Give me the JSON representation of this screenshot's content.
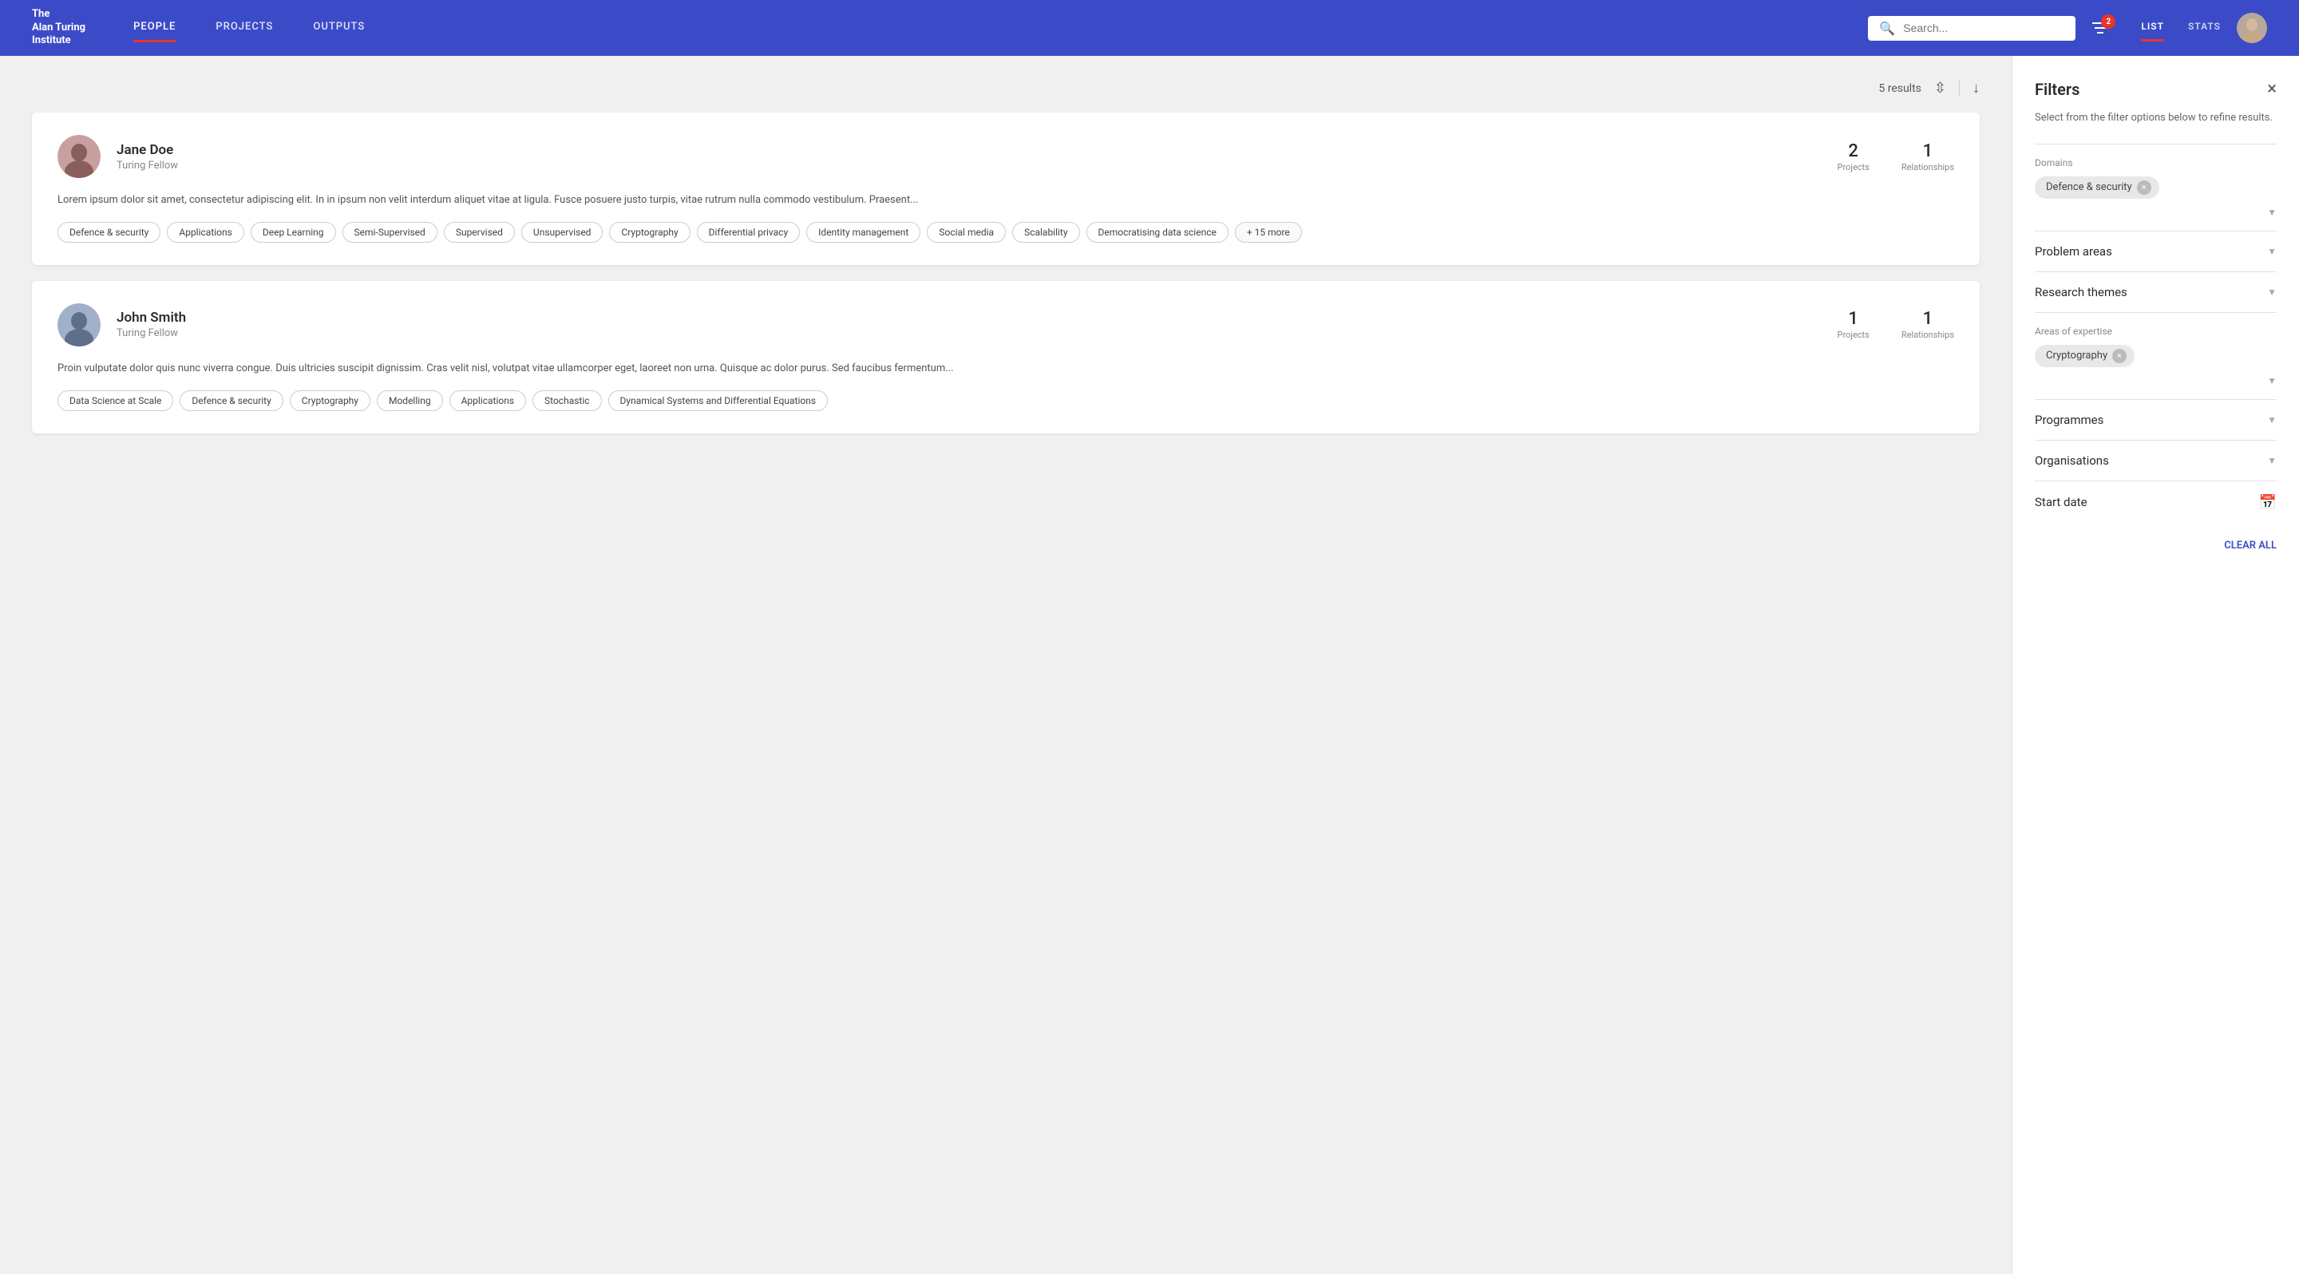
{
  "header": {
    "logo": [
      "The",
      "Alan Turing",
      "Institute"
    ],
    "nav": [
      {
        "label": "PEOPLE",
        "active": true
      },
      {
        "label": "PROJECTS",
        "active": false
      },
      {
        "label": "OUTPUTS",
        "active": false
      }
    ],
    "search_placeholder": "Search...",
    "filter_badge": "2",
    "view_tabs": [
      {
        "label": "LIST",
        "active": true
      },
      {
        "label": "STATS",
        "active": false
      }
    ]
  },
  "results": {
    "count": "5 results"
  },
  "people": [
    {
      "name": "Jane Doe",
      "role": "Turing Fellow",
      "projects": "2",
      "relationships": "1",
      "projects_label": "Projects",
      "relationships_label": "Relationships",
      "bio": "Lorem ipsum dolor sit amet, consectetur adipiscing elit. In in ipsum non velit interdum aliquet vitae at ligula. Fusce posuere justo turpis, vitae rutrum nulla commodo vestibulum. Praesent...",
      "tags": [
        "Defence & security",
        "Applications",
        "Deep Learning",
        "Semi-Supervised",
        "Supervised",
        "Unsupervised",
        "Cryptography",
        "Differential privacy",
        "Identity management",
        "Social media",
        "Scalability",
        "Democratising data science"
      ],
      "more": "+ 15 more"
    },
    {
      "name": "John Smith",
      "role": "Turing Fellow",
      "projects": "1",
      "relationships": "1",
      "projects_label": "Projects",
      "relationships_label": "Relationships",
      "bio": "Proin vulputate dolor quis nunc viverra congue. Duis ultricies suscipit dignissim. Cras velit nisl, volutpat vitae ullamcorper eget, laoreet non urna. Quisque ac dolor purus. Sed faucibus fermentum...",
      "tags": [
        "Data Science at Scale",
        "Defence & security",
        "Cryptography",
        "Modelling",
        "Applications",
        "Stochastic",
        "Dynamical Systems and Differential Equations"
      ],
      "more": null
    }
  ],
  "filters": {
    "title": "Filters",
    "subtitle": "Select from the filter options below to refine results.",
    "sections": [
      {
        "id": "domains",
        "label": "Domains",
        "active_tags": [
          "Defence & security"
        ],
        "has_chevron": true
      },
      {
        "id": "problem_areas",
        "label": "Problem areas",
        "active_tags": [],
        "has_chevron": true
      },
      {
        "id": "research_themes",
        "label": "Research themes",
        "active_tags": [],
        "has_chevron": true
      },
      {
        "id": "areas_of_expertise",
        "label": "Areas of expertise",
        "active_tags": [
          "Cryptography"
        ],
        "has_chevron": true
      },
      {
        "id": "programmes",
        "label": "Programmes",
        "active_tags": [],
        "has_chevron": true
      },
      {
        "id": "organisations",
        "label": "Organisations",
        "active_tags": [],
        "has_chevron": true
      },
      {
        "id": "start_date",
        "label": "Start date",
        "active_tags": [],
        "has_chevron": false,
        "has_calendar": true
      }
    ],
    "clear_all": "CLEAR ALL"
  }
}
